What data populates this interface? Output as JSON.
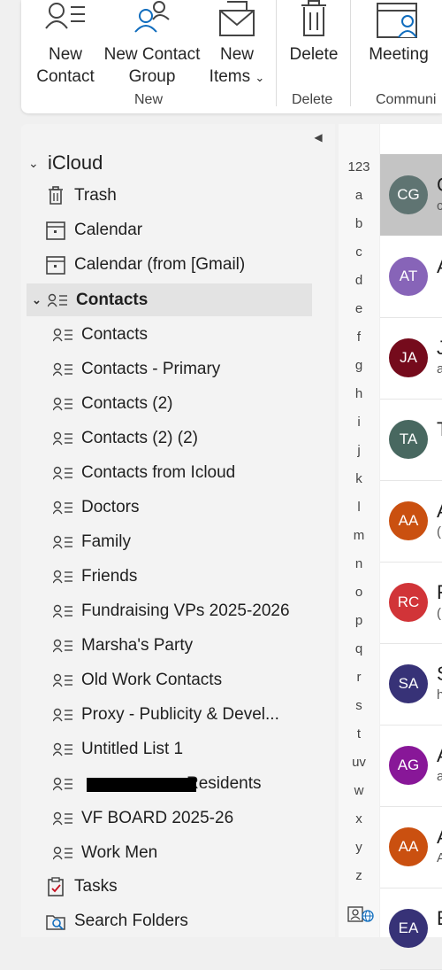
{
  "ribbon": {
    "new_contact": [
      "New",
      "Contact"
    ],
    "new_contact_group": [
      "New Contact",
      "Group"
    ],
    "new_items": [
      "New",
      "Items"
    ],
    "delete": "Delete",
    "meeting": "Meeting",
    "group_new": "New",
    "group_delete": "Delete",
    "group_communicate": "Communi"
  },
  "nav": {
    "account": "iCloud",
    "top_items": [
      "Trash",
      "Calendar",
      "Calendar (from [Gmail)"
    ],
    "contacts_label": "Contacts",
    "contact_folders": [
      "Contacts",
      "Contacts -  Primary",
      "Contacts (2)",
      "Contacts (2) (2)",
      "Contacts from Icloud",
      "Doctors",
      "Family",
      "Friends",
      "Fundraising VPs 2025-2026",
      "Marsha's Party",
      "Old Work Contacts",
      "Proxy - Publicity & Devel...",
      "Untitled List 1",
      "Residents",
      "VF BOARD 2025-26",
      "Work Men"
    ],
    "tasks": "Tasks",
    "search_folders": "Search Folders"
  },
  "alphabet": [
    "123",
    "a",
    "b",
    "c",
    "d",
    "e",
    "f",
    "g",
    "h",
    "i",
    "j",
    "k",
    "l",
    "m",
    "n",
    "o",
    "p",
    "q",
    "r",
    "s",
    "t",
    "uv",
    "w",
    "x",
    "y",
    "z"
  ],
  "contacts": [
    {
      "initials": "CG",
      "color": "#5f7472",
      "peek": "C",
      "peek2": "c"
    },
    {
      "initials": "AT",
      "color": "#8764b8",
      "peek": "A",
      "peek2": ""
    },
    {
      "initials": "JA",
      "color": "#750b1c",
      "peek": "J",
      "peek2": "a"
    },
    {
      "initials": "TA",
      "color": "#486860",
      "peek": "T",
      "peek2": ""
    },
    {
      "initials": "AA",
      "color": "#ca5010",
      "peek": "A",
      "peek2": "("
    },
    {
      "initials": "RC",
      "color": "#d13438",
      "peek": "F",
      "peek2": "("
    },
    {
      "initials": "SA",
      "color": "#373277",
      "peek": "S",
      "peek2": "h"
    },
    {
      "initials": "AG",
      "color": "#881798",
      "peek": "A",
      "peek2": "a"
    },
    {
      "initials": "AA",
      "color": "#ca5010",
      "peek": "A",
      "peek2": "A"
    },
    {
      "initials": "EA",
      "color": "#373277",
      "peek": "E",
      "peek2": ""
    }
  ]
}
